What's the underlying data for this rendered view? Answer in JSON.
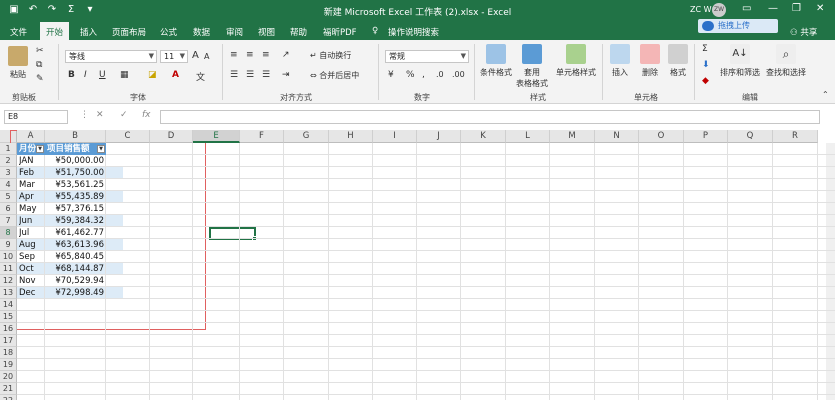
{
  "titlebar": {
    "save_icon": "save-icon",
    "undo_icon": "undo-icon",
    "redo_icon": "redo-icon",
    "sum_icon": "sigma-icon",
    "title": "新建 Microsoft Excel 工作表 (2).xlsx - Excel",
    "user": "ZC W",
    "avatar": "ZW",
    "upload_label": "拖拽上传",
    "min": "—",
    "restore": "❐",
    "close": "✕",
    "opt": "▭"
  },
  "menu": {
    "tabs": [
      "文件",
      "开始",
      "插入",
      "页面布局",
      "公式",
      "数据",
      "审阅",
      "视图",
      "帮助",
      "福昕PDF"
    ],
    "tell_me": "操作说明搜索",
    "share": "共享"
  },
  "ribbon": {
    "clipboard": {
      "paste": "粘贴",
      "label": "剪贴板"
    },
    "font": {
      "name": "等线",
      "size": "11",
      "label": "字体",
      "bold": "B",
      "italic": "I",
      "underline": "U",
      "font_color": "A",
      "grow": "A",
      "shrink": "A"
    },
    "alignment": {
      "wrap": "自动换行",
      "merge": "合并后居中",
      "label": "对齐方式"
    },
    "number": {
      "format": "常规",
      "label": "数字",
      "currency": "¥",
      "percent": "%",
      "comma": ","
    },
    "styles": {
      "cond": "条件格式",
      "table_line1": "套用",
      "table_line2": "表格格式",
      "cell": "单元格样式",
      "label": "样式"
    },
    "cells": {
      "insert": "插入",
      "delete": "删除",
      "format": "格式",
      "label": "单元格"
    },
    "editing": {
      "sort": "排序和筛选",
      "find": "查找和选择",
      "label": "编辑"
    }
  },
  "formula_bar": {
    "name_box": "E8",
    "cancel": "✕",
    "enter": "✓",
    "fx": "fx"
  },
  "grid": {
    "columns": [
      "A",
      "B",
      "C",
      "D",
      "E",
      "F",
      "G",
      "H",
      "I",
      "J",
      "K",
      "L",
      "M",
      "N",
      "O",
      "P",
      "Q",
      "R"
    ],
    "rows": [
      "1",
      "2",
      "3",
      "4",
      "5",
      "6",
      "7",
      "8",
      "9",
      "10",
      "11",
      "12",
      "13",
      "14",
      "15",
      "16",
      "17",
      "18",
      "19",
      "20",
      "21",
      "22"
    ],
    "header": {
      "month": "月份",
      "sales": "项目销售额"
    },
    "data": [
      {
        "month": "JAN",
        "sales": "¥50,000.00"
      },
      {
        "month": "Feb",
        "sales": "¥51,750.00"
      },
      {
        "month": "Mar",
        "sales": "¥53,561.25"
      },
      {
        "month": "Apr",
        "sales": "¥55,435.89"
      },
      {
        "month": "May",
        "sales": "¥57,376.15"
      },
      {
        "month": "Jun",
        "sales": "¥59,384.32"
      },
      {
        "month": "Jul",
        "sales": "¥61,462.77"
      },
      {
        "month": "Aug",
        "sales": "¥63,613.96"
      },
      {
        "month": "Sep",
        "sales": "¥65,840.45"
      },
      {
        "month": "Oct",
        "sales": "¥68,144.87"
      },
      {
        "month": "Nov",
        "sales": "¥70,529.94"
      },
      {
        "month": "Dec",
        "sales": "¥72,998.49"
      }
    ],
    "selected_cell": "E8"
  },
  "colors": {
    "excel_green": "#217346",
    "table_header": "#5b9bd5",
    "band": "#ddebf7",
    "highlight_box": "#e06060"
  }
}
